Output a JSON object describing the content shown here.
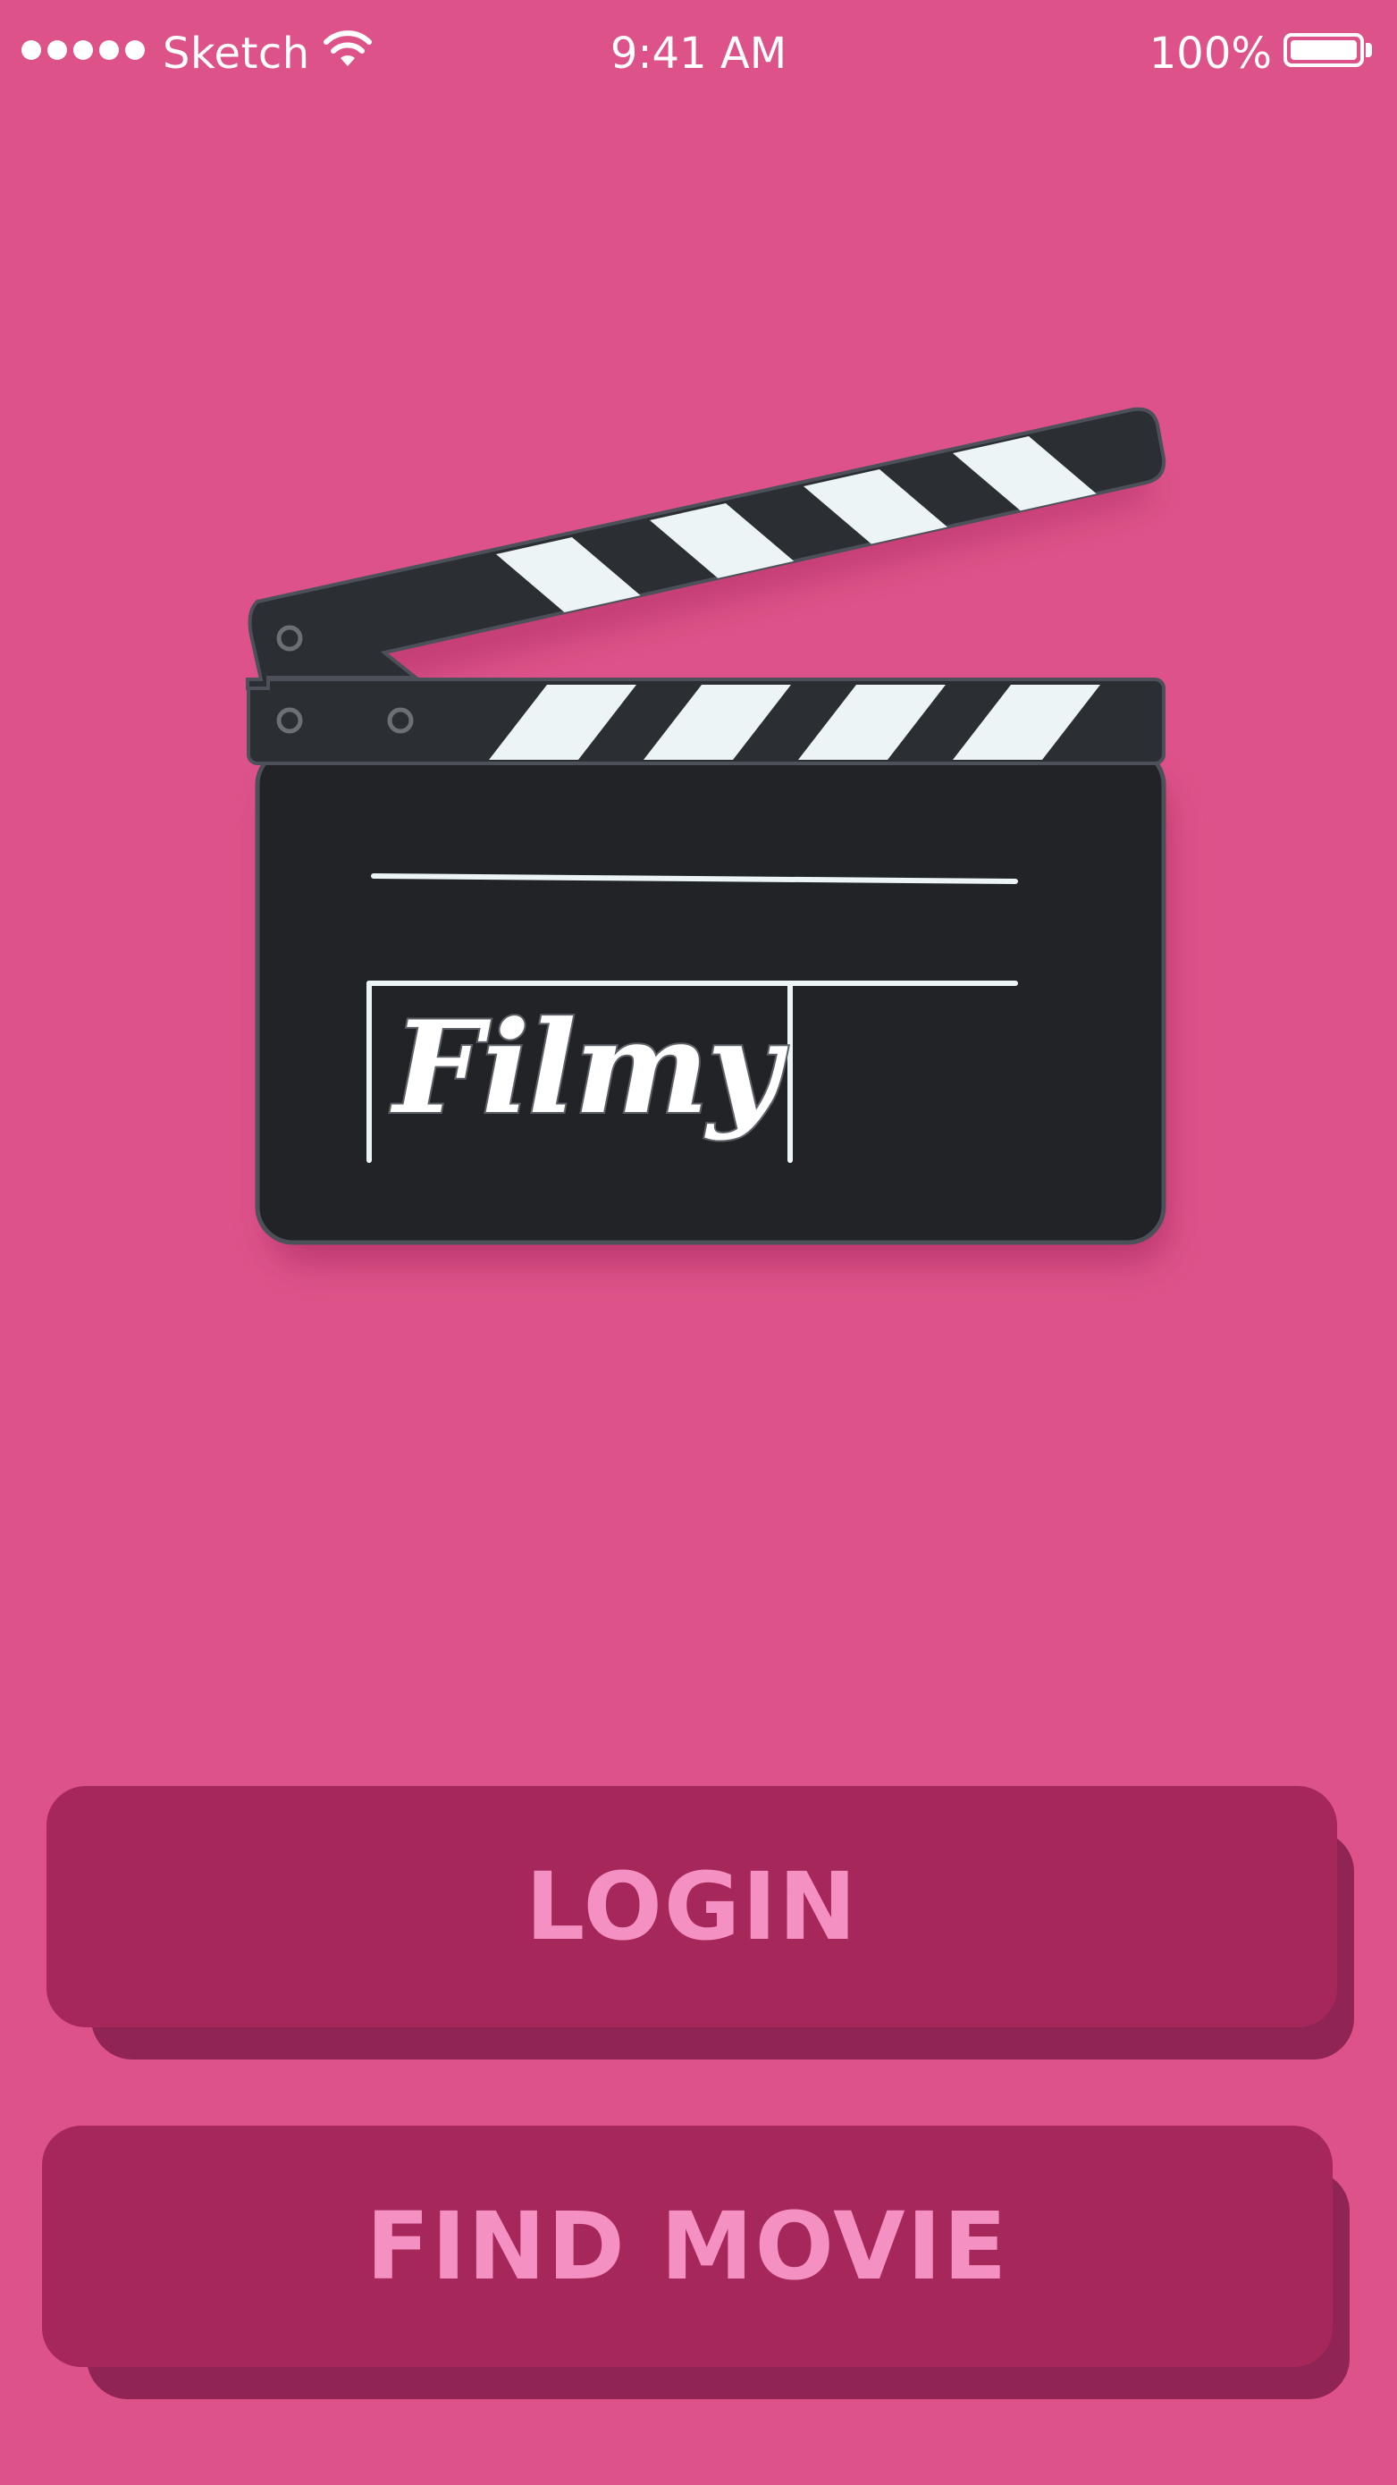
{
  "status_bar": {
    "carrier": "Sketch",
    "time": "9:41 AM",
    "battery_percent": "100%",
    "signal_bars": 5,
    "icons": [
      "signal-dots-icon",
      "wifi-icon",
      "battery-icon"
    ]
  },
  "logo": {
    "text": "Filmy",
    "icon": "clapperboard-icon"
  },
  "buttons": {
    "login_label": "LOGIN",
    "find_movie_label": "FIND MOVIE"
  },
  "colors": {
    "background": "#DD5389",
    "button": "#A6285B",
    "button_shadow": "#8F2455",
    "button_text": "#F590C2",
    "clapper_dark": "#212326",
    "clapper_stripe_light": "#ECF4F6"
  }
}
